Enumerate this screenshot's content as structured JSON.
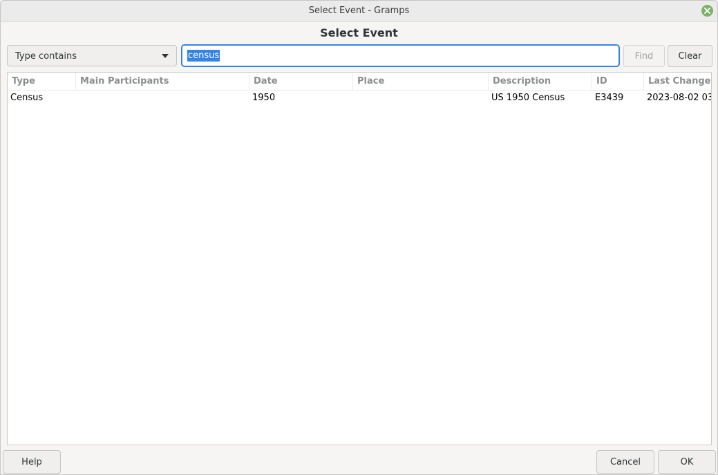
{
  "window": {
    "title": "Select Event - Gramps"
  },
  "dialog": {
    "heading": "Select Event"
  },
  "filter": {
    "selected": "Type contains",
    "search_value": "census",
    "find_label": "Find",
    "clear_label": "Clear"
  },
  "table": {
    "columns": [
      "Type",
      "Main Participants",
      "Date",
      "Place",
      "Description",
      "ID",
      "Last Change"
    ],
    "rows": [
      {
        "type": "Census",
        "main_participants": "",
        "date": "1950",
        "place": "",
        "description": "US 1950 Census",
        "id": "E3439",
        "last_change": "2023-08-02 03:"
      }
    ]
  },
  "footer": {
    "help_label": "Help",
    "cancel_label": "Cancel",
    "ok_label": "OK"
  },
  "colors": {
    "accent": "#3584e4",
    "close_button": "#7fb069"
  },
  "icons": {
    "close": "close-icon",
    "dropdown": "chevron-down-icon"
  }
}
